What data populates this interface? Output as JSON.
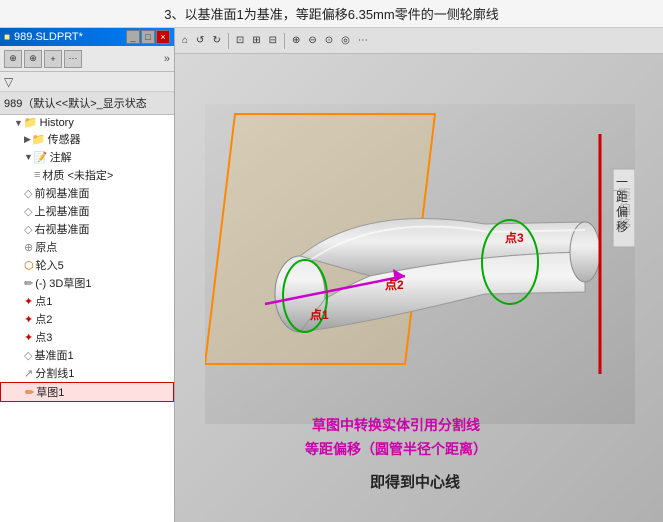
{
  "top_label": "3、以基准面1为基准，等距偏移6.35mm零件的一侧轮廓线",
  "window_title": "989.SLDPRT*",
  "part_title": "989（默认<<默认>_显示状态",
  "tree": {
    "history_label": "History",
    "items": [
      {
        "id": "sensors",
        "label": "传感器",
        "indent": 2,
        "icon": "folder",
        "expand": false
      },
      {
        "id": "annotations",
        "label": "注解",
        "indent": 2,
        "icon": "note",
        "expand": true
      },
      {
        "id": "material",
        "label": "材质 <未指定>",
        "indent": 3,
        "icon": "material"
      },
      {
        "id": "front_plane",
        "label": "前视基准面",
        "indent": 2,
        "icon": "plane"
      },
      {
        "id": "top_plane",
        "label": "上视基准面",
        "indent": 2,
        "icon": "plane"
      },
      {
        "id": "right_plane",
        "label": "右视基准面",
        "indent": 2,
        "icon": "plane"
      },
      {
        "id": "origin",
        "label": "原点",
        "indent": 2,
        "icon": "origin"
      },
      {
        "id": "loft5",
        "label": "轮入5",
        "indent": 2,
        "icon": "feature"
      },
      {
        "id": "3d_sketch1",
        "label": "(-) 3D草图1",
        "indent": 2,
        "icon": "3d"
      },
      {
        "id": "point1",
        "label": "点1",
        "indent": 2,
        "icon": "point"
      },
      {
        "id": "point2",
        "label": "点2",
        "indent": 2,
        "icon": "point"
      },
      {
        "id": "point3",
        "label": "点3",
        "indent": 2,
        "icon": "point"
      },
      {
        "id": "datum1",
        "label": "基准面1",
        "indent": 2,
        "icon": "plane"
      },
      {
        "id": "splitline1",
        "label": "分割线1",
        "indent": 2,
        "icon": "split"
      },
      {
        "id": "sketch1",
        "label": "草图1",
        "indent": 2,
        "icon": "sketch",
        "selected": true
      }
    ]
  },
  "viewport": {
    "vertical_text": "一距偏移",
    "annotation_magenta_line1": "草图中转换实体引用分割线",
    "annotation_magenta_line2": "等距偏移（圆管半径个距离）",
    "annotation_black": "即得到中心线",
    "point_labels": [
      {
        "id": "p1",
        "label": "点1"
      },
      {
        "id": "p2",
        "label": "点2"
      },
      {
        "id": "p3",
        "label": "点3"
      }
    ]
  },
  "toolbar_left": {
    "buttons": [
      "⊕",
      "⊕",
      "+",
      "⋯"
    ],
    "arrow": "»"
  },
  "toolbar_right": {
    "buttons": [
      "⌂",
      "↺",
      "↻",
      "⊡",
      "⊞",
      "⊟",
      "⊕",
      "⊖",
      "⊙",
      "◎",
      "⊡",
      "⋯"
    ]
  },
  "window_controls": {
    "min": "_",
    "max": "□",
    "close": "×"
  }
}
